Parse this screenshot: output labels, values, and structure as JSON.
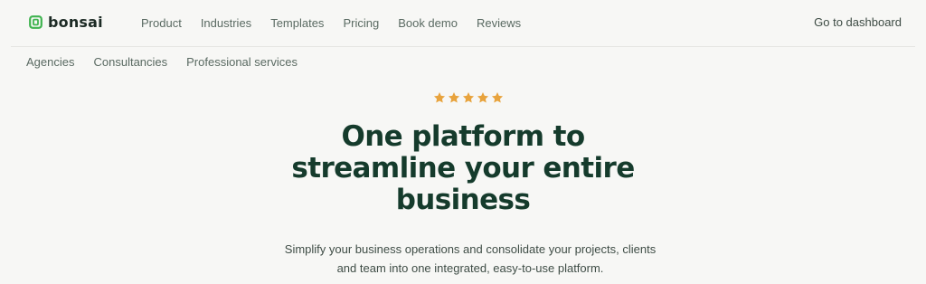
{
  "brand": {
    "name": "bonsai",
    "accent_color": "#3fb34f",
    "heading_color": "#153b2c"
  },
  "nav": {
    "items": [
      "Product",
      "Industries",
      "Templates",
      "Pricing",
      "Book demo",
      "Reviews"
    ],
    "dashboard_label": "Go to dashboard"
  },
  "subnav": {
    "items": [
      "Agencies",
      "Consultancies",
      "Professional services"
    ]
  },
  "hero": {
    "rating": 5,
    "rating_max": 5,
    "star_color": "#e8a33d",
    "headline_lines": [
      "One platform to",
      "streamline your entire",
      "business"
    ],
    "subtext_lines": [
      "Simplify your business operations and consolidate your projects, clients",
      "and team into one integrated, easy-to-use platform."
    ]
  }
}
